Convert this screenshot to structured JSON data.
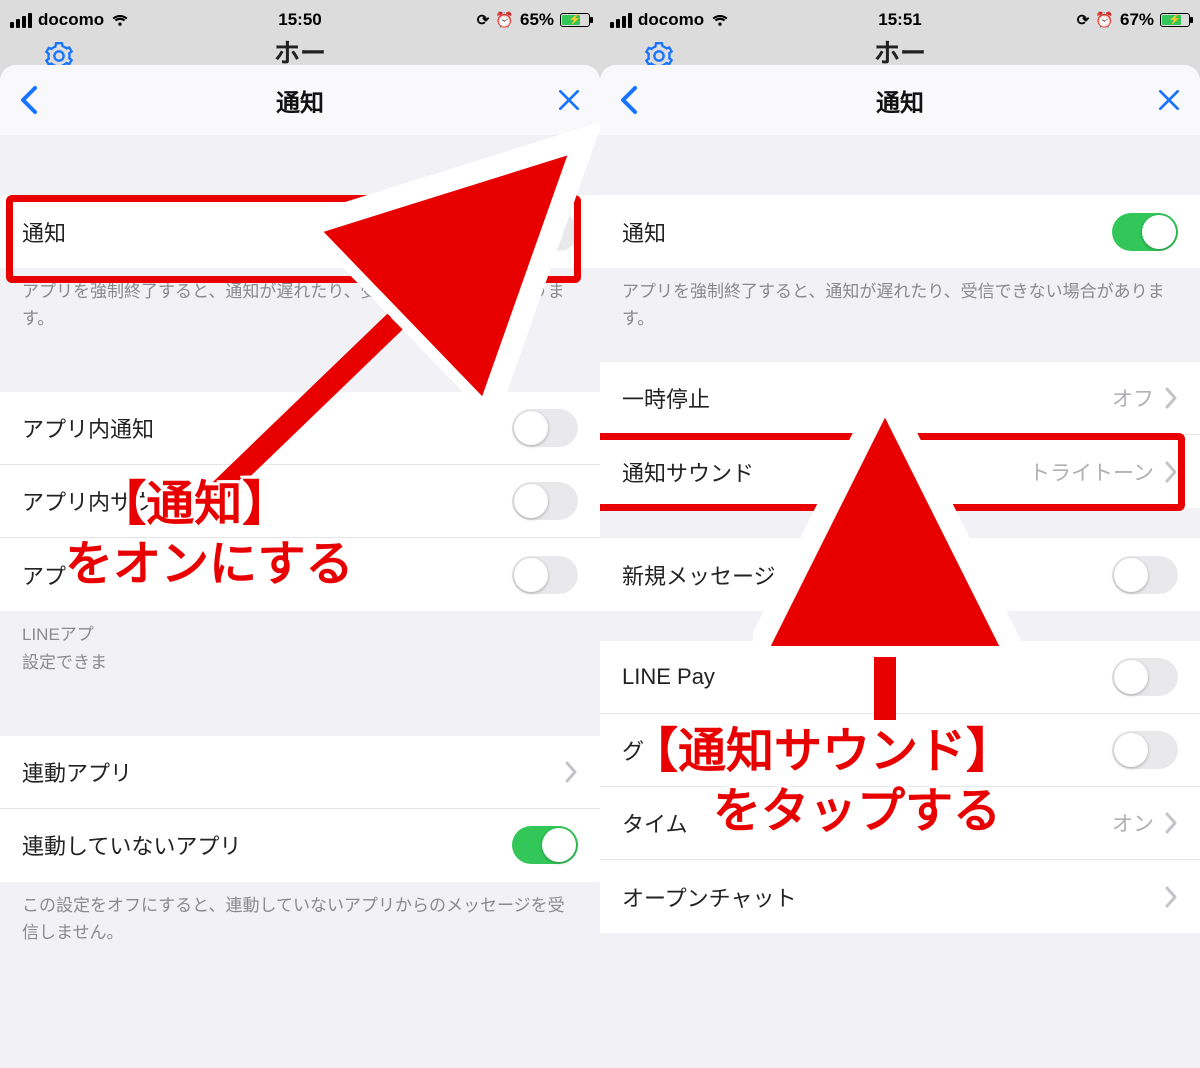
{
  "left": {
    "status": {
      "carrier": "docomo",
      "time": "15:50",
      "battery_pct": "65%"
    },
    "bg_peek_title": "ホーム",
    "nav_title": "通知",
    "row_notify": "通知",
    "note1": "アプリを強制終了すると、通知が遅れたり、受信できない場合があります。",
    "row_inapp_notify": "アプリ内通知",
    "row_inapp_sound": "アプリ内サウンド",
    "row_inapp_vibe_prefix": "アプ",
    "note2_prefix": "LINEアプ",
    "note2_suffix": "設定できま",
    "row_linked_apps": "連動アプリ",
    "row_unlinked_apps": "連動していないアプリ",
    "note3": "この設定をオフにすると、連動していないアプリからのメッセージを受信しません。",
    "anno_line1": "【通知】",
    "anno_line2": "をオンにする"
  },
  "right": {
    "status": {
      "carrier": "docomo",
      "time": "15:51",
      "battery_pct": "67%"
    },
    "bg_peek_title": "ホーム",
    "nav_title": "通知",
    "row_notify": "通知",
    "note1": "アプリを強制終了すると、通知が遅れたり、受信できない場合があります。",
    "row_pause": "一時停止",
    "row_pause_value": "オフ",
    "row_sound": "通知サウンド",
    "row_sound_value": "トライトーン",
    "row_new_msg": "新規メッセージ",
    "row_line_pay": "LINE Pay",
    "row_group_prefix": "グ",
    "row_timeline_prefix": "タイム",
    "row_timeline_value": "オン",
    "row_openchat": "オープンチャット",
    "anno_line1": "【通知サウンド】",
    "anno_line2": "をタップする"
  }
}
